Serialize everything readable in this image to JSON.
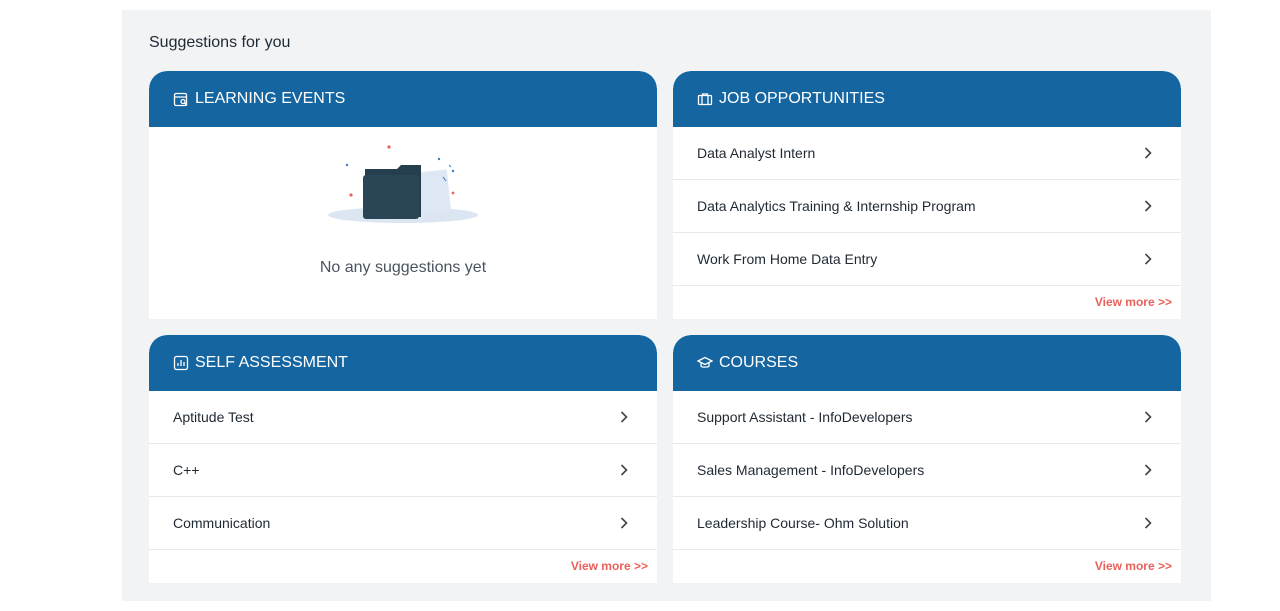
{
  "section_title": "Suggestions for you",
  "learning_events": {
    "title": "LEARNING EVENTS",
    "icon": "calendar-search-icon",
    "empty_text": "No any suggestions yet"
  },
  "job_opportunities": {
    "title": "JOB OPPORTUNITIES",
    "icon": "briefcase-icon",
    "items": [
      {
        "label": "Data Analyst Intern"
      },
      {
        "label": "Data Analytics Training & Internship Program"
      },
      {
        "label": "Work From Home Data Entry"
      }
    ],
    "view_more": "View more >>"
  },
  "self_assessment": {
    "title": "SELF ASSESSMENT",
    "icon": "bar-chart-icon",
    "items": [
      {
        "label": "Aptitude Test"
      },
      {
        "label": "C++"
      },
      {
        "label": "Communication"
      }
    ],
    "view_more": "View more >>"
  },
  "courses": {
    "title": "COURSES",
    "icon": "graduation-cap-icon",
    "items": [
      {
        "label": "Support Assistant - InfoDevelopers"
      },
      {
        "label": "Sales Management - InfoDevelopers"
      },
      {
        "label": "Leadership Course- Ohm Solution"
      }
    ],
    "view_more": "View more >>"
  },
  "colors": {
    "header": "#1565a0",
    "view_more": "#e8615a",
    "panel_bg": "#f2f3f5"
  }
}
